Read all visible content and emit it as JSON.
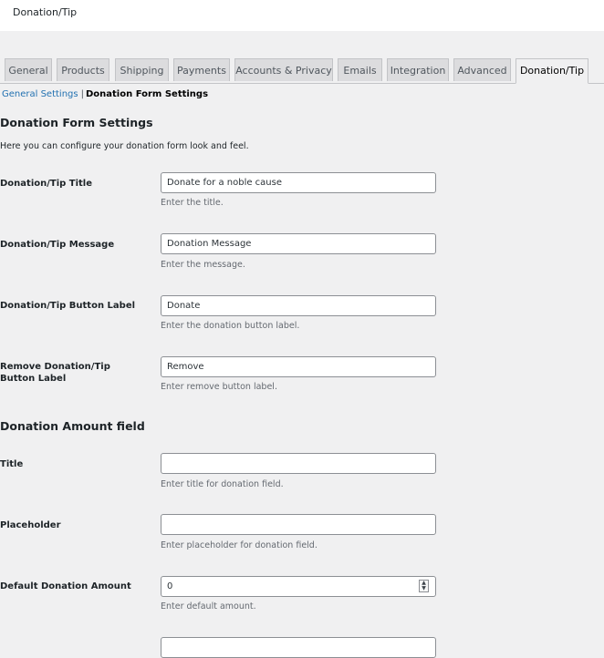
{
  "topbar": {
    "title": "Donation/Tip"
  },
  "tabs": [
    {
      "label": "General"
    },
    {
      "label": "Products"
    },
    {
      "label": "Shipping"
    },
    {
      "label": "Payments"
    },
    {
      "label": "Accounts & Privacy"
    },
    {
      "label": "Emails"
    },
    {
      "label": "Integration"
    },
    {
      "label": "Advanced"
    },
    {
      "label": "Donation/Tip",
      "active": true
    }
  ],
  "subnav": {
    "general_settings": "General Settings",
    "separator": "|",
    "current": "Donation Form Settings"
  },
  "form_settings": {
    "heading": "Donation Form Settings",
    "intro": "Here you can configure your donation form look and feel.",
    "fields": [
      {
        "label": "Donation/Tip Title",
        "value": "Donate for a noble cause",
        "description": "Enter the title."
      },
      {
        "label": "Donation/Tip Message",
        "value": "Donation Message",
        "description": "Enter the message."
      },
      {
        "label": "Donation/Tip Button Label",
        "value": "Donate",
        "description": "Enter the donation button label."
      },
      {
        "label": "Remove Donation/Tip Button Label",
        "value": "Remove",
        "description": "Enter remove button label."
      }
    ]
  },
  "amount_field": {
    "heading": "Donation Amount field",
    "fields": [
      {
        "label": "Title",
        "value": "",
        "description": "Enter title for donation field."
      },
      {
        "label": "Placeholder",
        "value": "",
        "description": "Enter placeholder for donation field."
      },
      {
        "label": "Default Donation Amount",
        "value": "0",
        "description": "Enter default amount."
      }
    ]
  }
}
